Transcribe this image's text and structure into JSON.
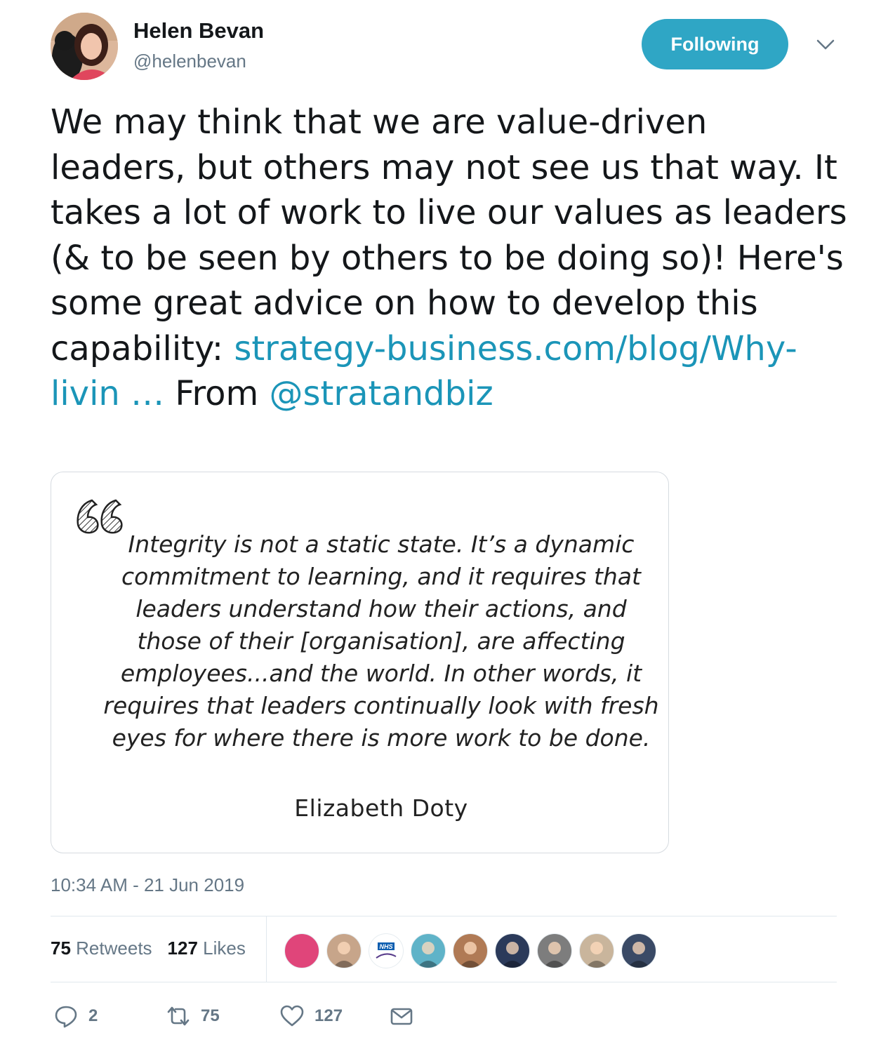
{
  "user": {
    "name": "Helen Bevan",
    "handle": "@helenbevan",
    "follow_label": "Following"
  },
  "tweet": {
    "text_before": "We may think that we are value-driven leaders, but others may not see us that way. It takes a lot of work to live our values as leaders (& to be seen by others to be doing so)! Here's some great advice on how to develop this capability: ",
    "link": "strategy-business.com/blog/Why-livin …",
    "text_middle": " From ",
    "mention": "@stratandbiz",
    "timestamp": "10:34 AM - 21 Jun 2019"
  },
  "card": {
    "quote": "Integrity is not a static state. It’s a dynamic commitment to learning, and it requires that leaders understand how their actions, and those of their [organisation], are affecting employees...and the world. In other words, it requires that leaders continually look with fresh eyes for where there is more work to be done.",
    "author": "Elizabeth Doty"
  },
  "stats": {
    "retweets_count": "75",
    "retweets_label": "Retweets",
    "likes_count": "127",
    "likes_label": "Likes"
  },
  "likers": [
    {
      "icon": "liker-avatar-pink",
      "color": "#e0457a"
    },
    {
      "icon": "liker-avatar-man",
      "color": "#c7a58a"
    },
    {
      "icon": "liker-avatar-nhs",
      "color": "#ffffff",
      "label": "NHS"
    },
    {
      "icon": "liker-avatar-teal",
      "color": "#5fb3c8"
    },
    {
      "icon": "liker-avatar-woman",
      "color": "#b07a55"
    },
    {
      "icon": "liker-avatar-landscape",
      "color": "#2b3a5a"
    },
    {
      "icon": "liker-avatar-portrait-bw",
      "color": "#7d7d7d"
    },
    {
      "icon": "liker-avatar-woman-sun",
      "color": "#c9b59c"
    },
    {
      "icon": "liker-avatar-man-dark",
      "color": "#3a4a66"
    }
  ],
  "actions": {
    "reply_count": "2",
    "retweet_count": "75",
    "like_count": "127"
  },
  "colors": {
    "accent": "#2fa6c5",
    "link": "#1b95b8",
    "secondary_text": "#657786"
  }
}
